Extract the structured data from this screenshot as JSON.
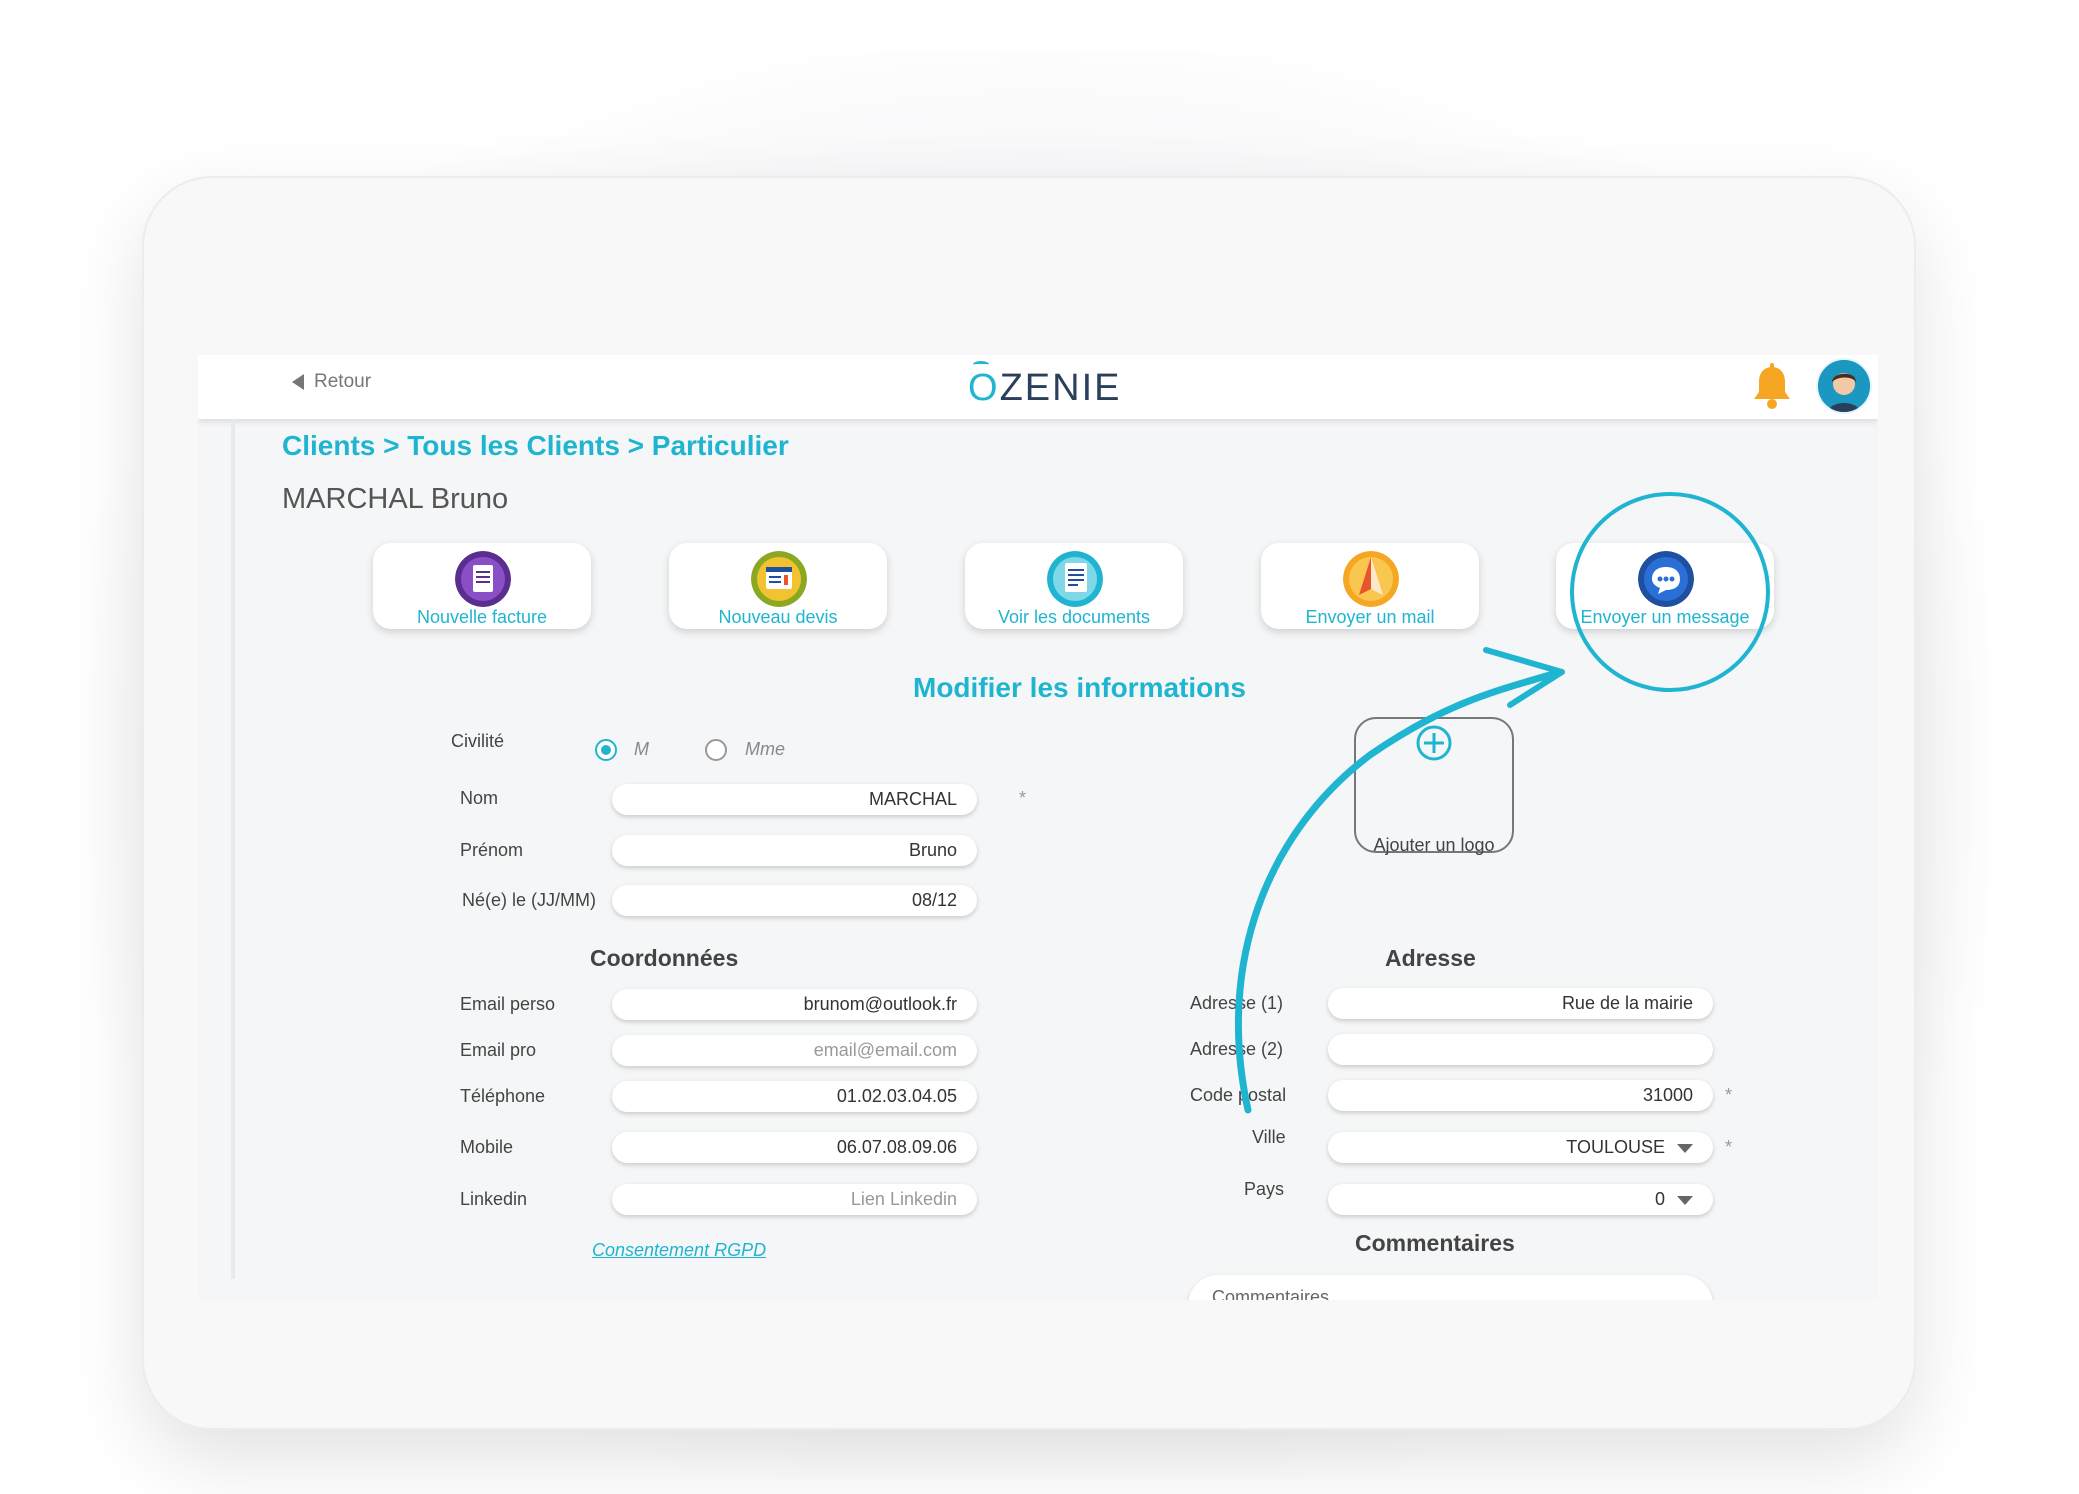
{
  "header": {
    "back_label": "Retour",
    "logo_letter": "O",
    "logo_rest": "ZENIE"
  },
  "breadcrumb": "Clients > Tous les Clients > Particulier",
  "client_name": "MARCHAL Bruno",
  "actions": [
    {
      "label": "Nouvelle facture",
      "icon": "invoice-icon",
      "color": "#5b2d8e"
    },
    {
      "label": "Nouveau devis",
      "icon": "quote-icon",
      "color": "#8aa821"
    },
    {
      "label": "Voir les documents",
      "icon": "documents-icon",
      "color": "#1fb5d1"
    },
    {
      "label": "Envoyer un mail",
      "icon": "paper-plane-icon",
      "color": "#f5a623"
    },
    {
      "label": "Envoyer un message",
      "icon": "chat-bubble-icon",
      "color": "#1e4fa0"
    }
  ],
  "form": {
    "title": "Modifier les informations",
    "civility_label": "Civilité",
    "civility_options": [
      "M",
      "Mme"
    ],
    "civility_selected": "M",
    "last_name_label": "Nom",
    "last_name_value": "MARCHAL",
    "first_name_label": "Prénom",
    "first_name_value": "Bruno",
    "birth_label": "Né(e) le (JJ/MM)",
    "birth_value": "08/12",
    "required_mark": "*",
    "add_logo_label": "Ajouter un logo"
  },
  "contact": {
    "title": "Coordonnées",
    "email_perso_label": "Email perso",
    "email_perso_value": "brunom@outlook.fr",
    "email_pro_label": "Email pro",
    "email_pro_placeholder": "email@email.com",
    "phone_label": "Téléphone",
    "phone_value": "01.02.03.04.05",
    "mobile_label": "Mobile",
    "mobile_value": "06.07.08.09.06",
    "linkedin_label": "Linkedin",
    "linkedin_placeholder": "Lien Linkedin",
    "rgpd_link": "Consentement RGPD"
  },
  "address": {
    "title": "Adresse",
    "address1_label": "Adresse (1)",
    "address1_value": "Rue de la mairie",
    "address2_label": "Adresse (2)",
    "postal_label": "Code postal",
    "postal_value": "31000",
    "city_label": "Ville",
    "city_value": "TOULOUSE",
    "country_label": "Pays",
    "country_value": "0"
  },
  "comments": {
    "title": "Commentaires",
    "placeholder": "Commentaires"
  },
  "colors": {
    "accent": "#1fb5d1",
    "bell": "#f5a623",
    "text": "#444444"
  }
}
